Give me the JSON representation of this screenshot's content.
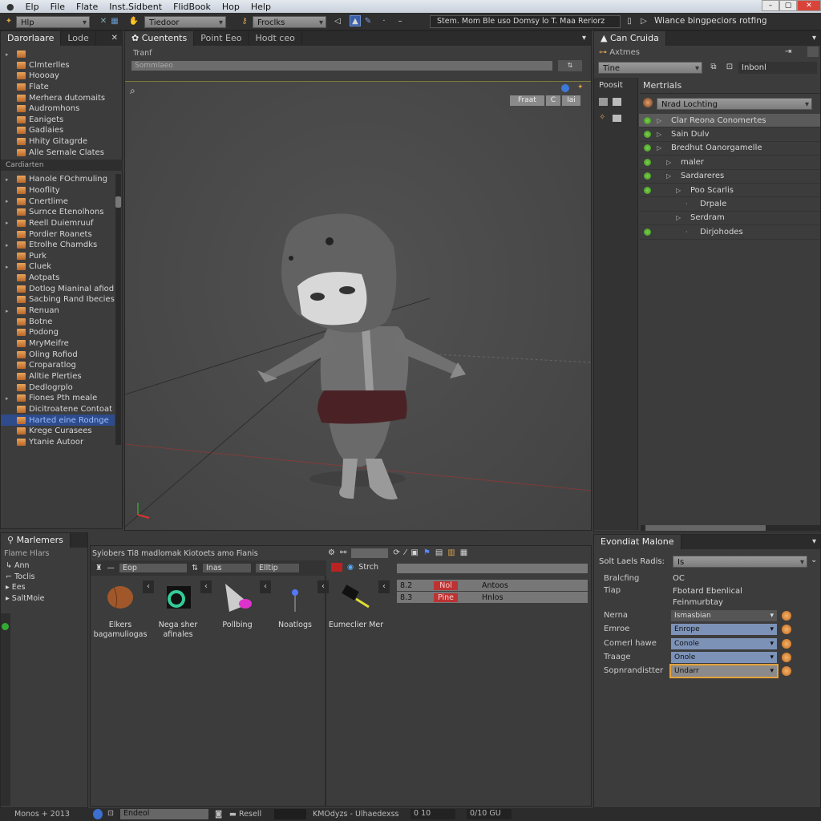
{
  "menubar": {
    "items": [
      "Elp",
      "File",
      "Flate",
      "Inst.Sidbent",
      "FlidBook",
      "Hop",
      "Help"
    ]
  },
  "toolbar": {
    "combo1": "Hlp",
    "combo2": "Tiedoor",
    "combo3": "Froclks",
    "status_text": "Stem. Mom Ble uso Domsy lo  T. Maa Reriorz",
    "right_text": "Wiance bingpeciors rotfing"
  },
  "left_panel": {
    "tabs": [
      "Darorlaare",
      "Lode"
    ],
    "top_items": [
      "",
      "Clmterlles",
      "Hoooay",
      "Flate",
      "Merhera dutomaits",
      "Audromhons",
      "Eanigets",
      "Gadlaies",
      "Hhity Gitagrde",
      "Alle Sernale Clates"
    ],
    "section": "Cardiarten",
    "items": [
      "Hanole FOchmuling",
      "Hooflity",
      "Cnertlime",
      "Surnce Etenolhons",
      "Reell Duiemruuf",
      "Pordier Roanets",
      "Etrolhe Chamdks",
      "Purk",
      "Cluek",
      "Aotpats",
      "Dotlog Mianinal afiod",
      "Sacbing Rand Ibecies",
      "Renuan",
      "Botne",
      "Podong",
      "MryMeifre",
      "Oling Rofiod",
      "Croparatlog",
      "Alltie Plerties",
      "Dedlogrplo",
      "Fiones Pth meale",
      "Dicitroatene Contoat",
      "Harted eine Rodnge",
      "Krege Curasees",
      "Ytanie Autoor"
    ],
    "selected_index": 22
  },
  "viewport": {
    "tabs": [
      "Cuentents",
      "Point Eeo",
      "Hodt ceo"
    ],
    "label": "Tranf",
    "input_value": "Sommlaeo",
    "buttons": [
      "Fraat",
      "C",
      "Iai"
    ]
  },
  "right_panel": {
    "tab": "Can Cruida",
    "subheader": "Axtmes",
    "combo": "Tine",
    "field": "Inbonl",
    "side_label": "Poosit",
    "header": "Mertrials",
    "material_select": "Nrad Lochting",
    "tree": [
      {
        "label": "Clar Reona Conomertes",
        "dot": true,
        "depth": 0
      },
      {
        "label": "Sain Dulv",
        "dot": true,
        "depth": 0
      },
      {
        "label": "Bredhut Oanorgamelle",
        "dot": true,
        "depth": 0
      },
      {
        "label": "maler",
        "dot": true,
        "depth": 1
      },
      {
        "label": "Sardareres",
        "dot": true,
        "depth": 1
      },
      {
        "label": "Poo Scarlis",
        "dot": true,
        "depth": 2
      },
      {
        "label": "Drpale",
        "dot": false,
        "depth": 3
      },
      {
        "label": "Serdram",
        "dot": false,
        "depth": 2
      },
      {
        "label": "Dirjohodes",
        "dot": true,
        "depth": 3
      }
    ]
  },
  "bottom_left": {
    "tab": "Marlemers",
    "header": "Flame Hlars",
    "items": [
      "Ann",
      "Toclis",
      "Ees",
      "SaltMoie"
    ]
  },
  "assets": {
    "header": "Syiobers  Ti8 madlomak Kiotoets amo Fianis",
    "filter1": "Eop",
    "filter2": "Inas",
    "filter3": "Elltip",
    "search_label": "Strch",
    "items": [
      "Elkers bagamuliogas",
      "Nega sher afinales",
      "Pollbing",
      "Noatlogs",
      "Eumeclier Mer"
    ],
    "rows": [
      {
        "num": "8.2",
        "tag": "Nol",
        "name": "Antoos"
      },
      {
        "num": "8.3",
        "tag": "Pine",
        "name": "Hnlos"
      }
    ]
  },
  "properties": {
    "tab": "Evondiat Malone",
    "sort_label": "Solt Laels Radis:",
    "sort_value": "Is",
    "info": [
      {
        "label": "Bralcfing",
        "value": "OC"
      },
      {
        "label": "Tiap",
        "value": "Fbotard Ebenlical Feinmurbtay"
      }
    ],
    "fields": [
      {
        "label": "Nerna",
        "value": "Ismasbian"
      },
      {
        "label": "Emroe",
        "value": "Enrope"
      },
      {
        "label": "Comerl hawe",
        "value": "Conole"
      },
      {
        "label": "Traage",
        "value": "Onole"
      },
      {
        "label": "Sopnrandistter",
        "value": "Undarr"
      }
    ]
  },
  "statusbar": {
    "left": "Monos  + 2013",
    "input": "Endeol",
    "reset": "Resell",
    "mode": "KMOdyzs - Ulhaedexss",
    "v1": "0 10",
    "v2": "0/10  GU"
  },
  "colors": {
    "accent": "#2e4b8c",
    "viewport": "#4b4b4b",
    "highlight": "#e6a23a"
  }
}
